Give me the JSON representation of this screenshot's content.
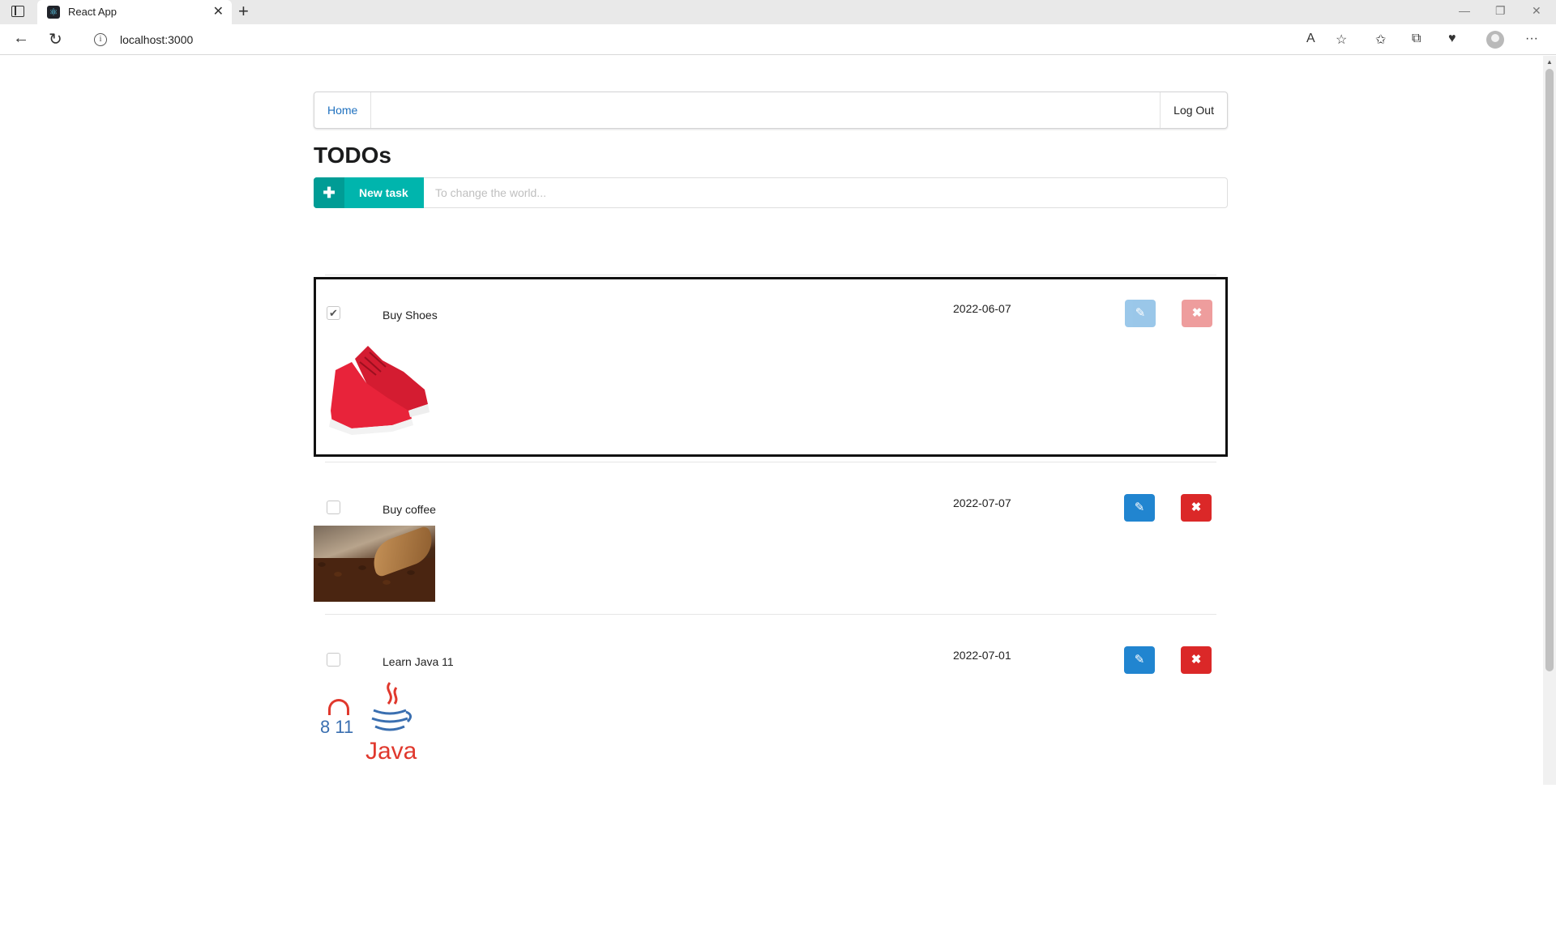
{
  "browser": {
    "tab_title": "React App",
    "url": "localhost:3000"
  },
  "nav": {
    "home_label": "Home",
    "logout_label": "Log Out"
  },
  "page": {
    "title": "TODOs"
  },
  "new_task": {
    "button_label": "New task",
    "placeholder": "To change the world..."
  },
  "todos": [
    {
      "title": "Buy Shoes",
      "date": "2022-06-07",
      "checked": true,
      "image": "red-sneakers"
    },
    {
      "title": "Buy coffee",
      "date": "2022-07-07",
      "checked": false,
      "image": "coffee-beans"
    },
    {
      "title": "Learn Java 11",
      "date": "2022-07-01",
      "checked": false,
      "image": "java-logo"
    }
  ],
  "java_image": {
    "version_from": "8",
    "version_to": "11",
    "wordmark": "Java"
  },
  "colors": {
    "accent": "#00b5ad",
    "edit": "#2185d0",
    "delete": "#db2828",
    "link": "#1e70bf"
  }
}
